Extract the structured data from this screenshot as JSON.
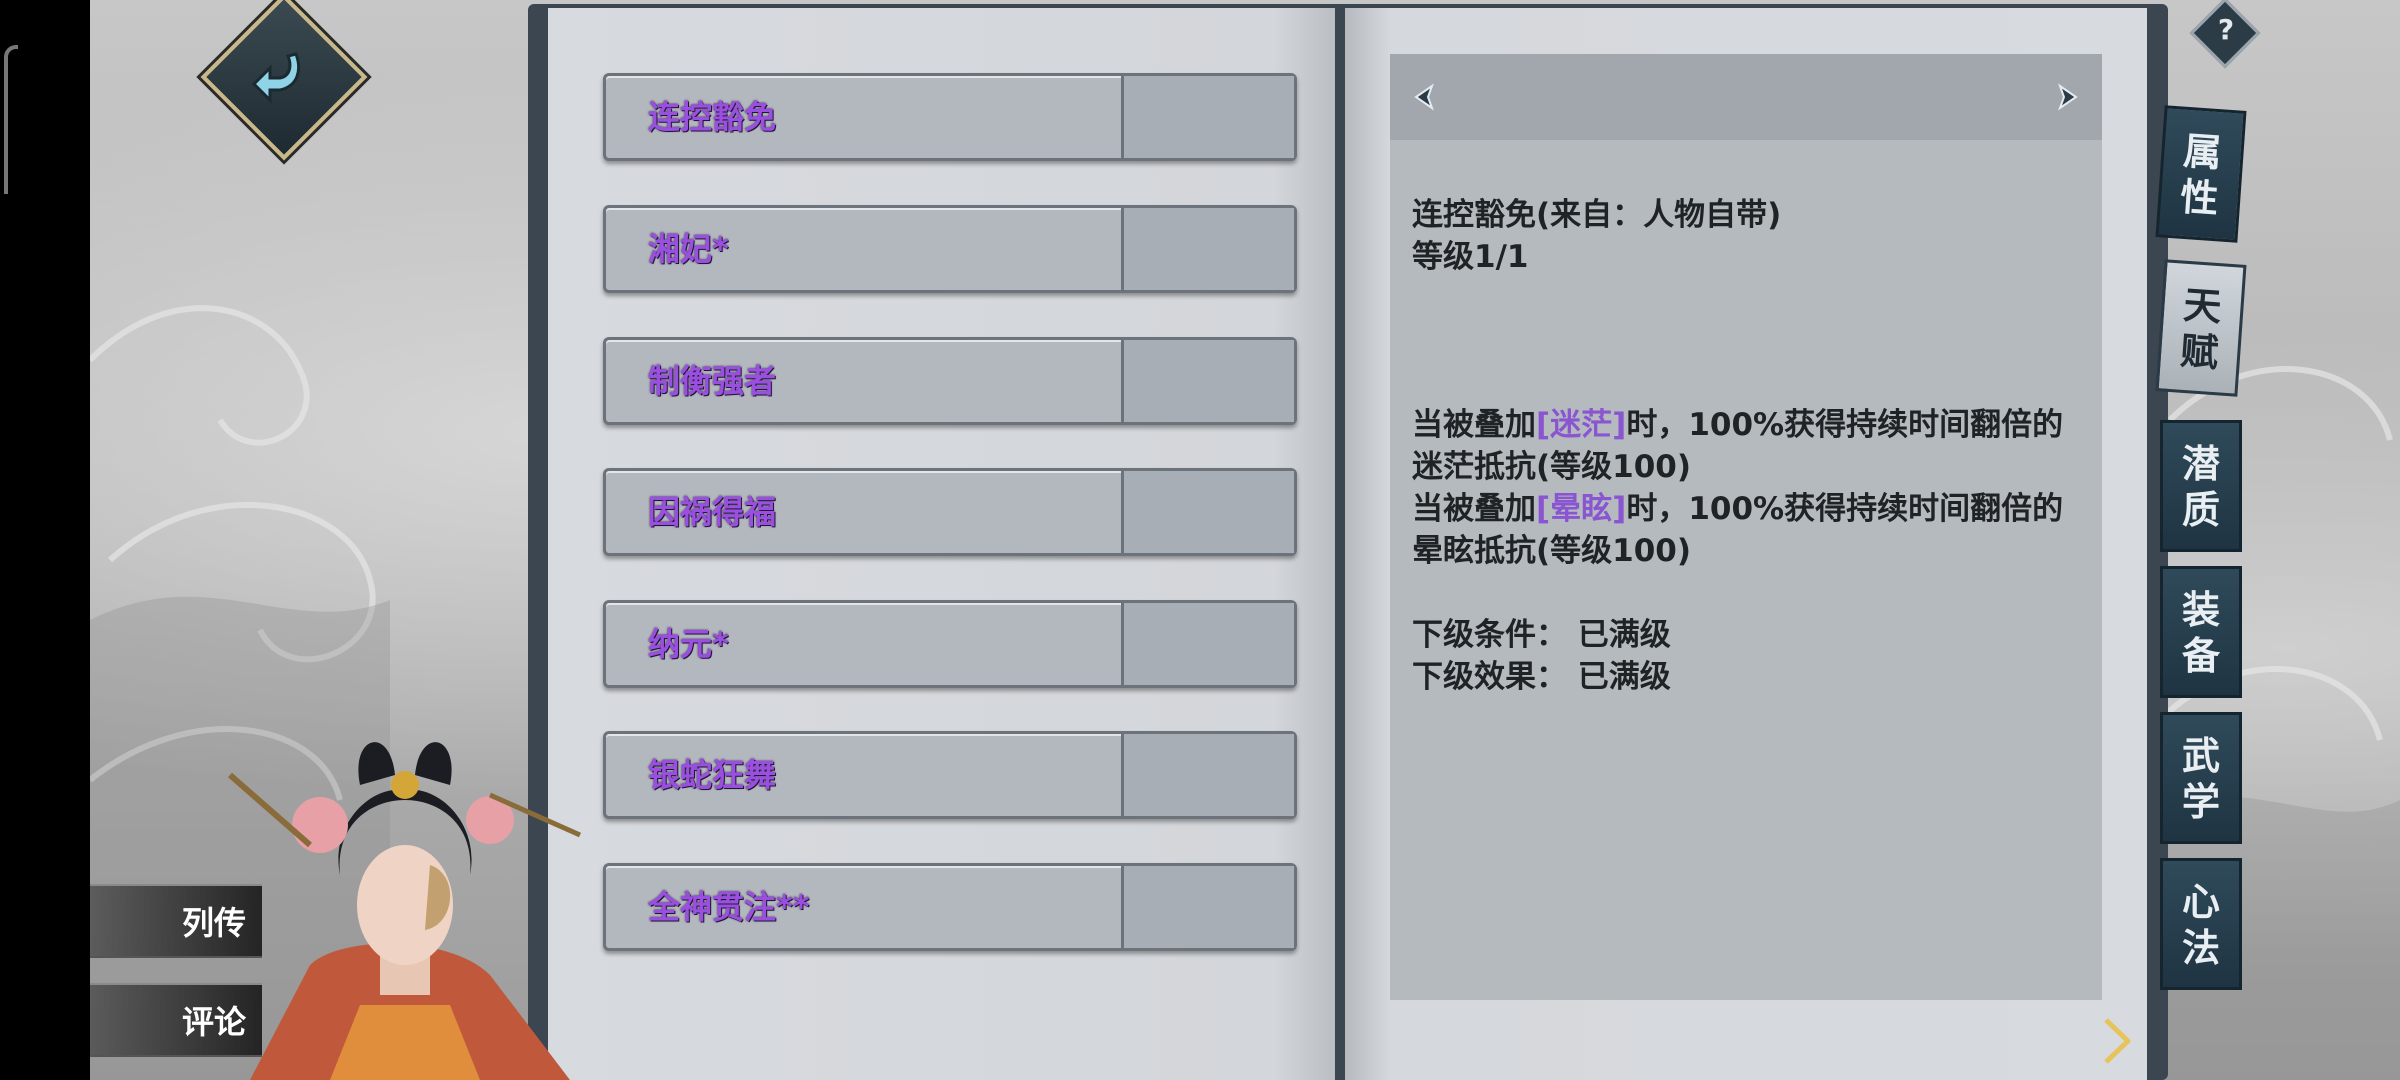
{
  "skills": [
    {
      "name": "连控豁免"
    },
    {
      "name": "湘妃*"
    },
    {
      "name": "制衡强者"
    },
    {
      "name": "因祸得福"
    },
    {
      "name": "纳元*"
    },
    {
      "name": "银蛇狂舞"
    },
    {
      "name": "全神贯注**"
    }
  ],
  "detail": {
    "title": "连控豁免(来自：人物自带)",
    "level": "等级1/1",
    "effect1_pre": "当被叠加",
    "effect1_tag": "[迷茫]",
    "effect1_post": "时，100%获得持续时间翻倍的",
    "effect1_line2": "迷茫抵抗(等级100)",
    "effect2_pre": "当被叠加",
    "effect2_tag": "[晕眩]",
    "effect2_post": "时，100%获得持续时间翻倍的",
    "effect2_line2": "晕眩抵抗(等级100)",
    "next_condition": "下级条件： 已满级",
    "next_effect": "下级效果： 已满级"
  },
  "tabs": [
    {
      "label": [
        "属",
        "性"
      ],
      "active": false
    },
    {
      "label": [
        "天",
        "赋"
      ],
      "active": true
    },
    {
      "label": [
        "潜",
        "质"
      ],
      "active": false
    },
    {
      "label": [
        "装",
        "备"
      ],
      "active": false
    },
    {
      "label": [
        "武",
        "学"
      ],
      "active": false
    },
    {
      "label": [
        "心",
        "法"
      ],
      "active": false
    }
  ],
  "side_buttons": {
    "biography": "列传",
    "comments": "评论"
  },
  "help": "?",
  "colors": {
    "skill_name": "#9b4fe0",
    "tag": "#8a55d0",
    "tab_bg": "#2f4a5a"
  }
}
